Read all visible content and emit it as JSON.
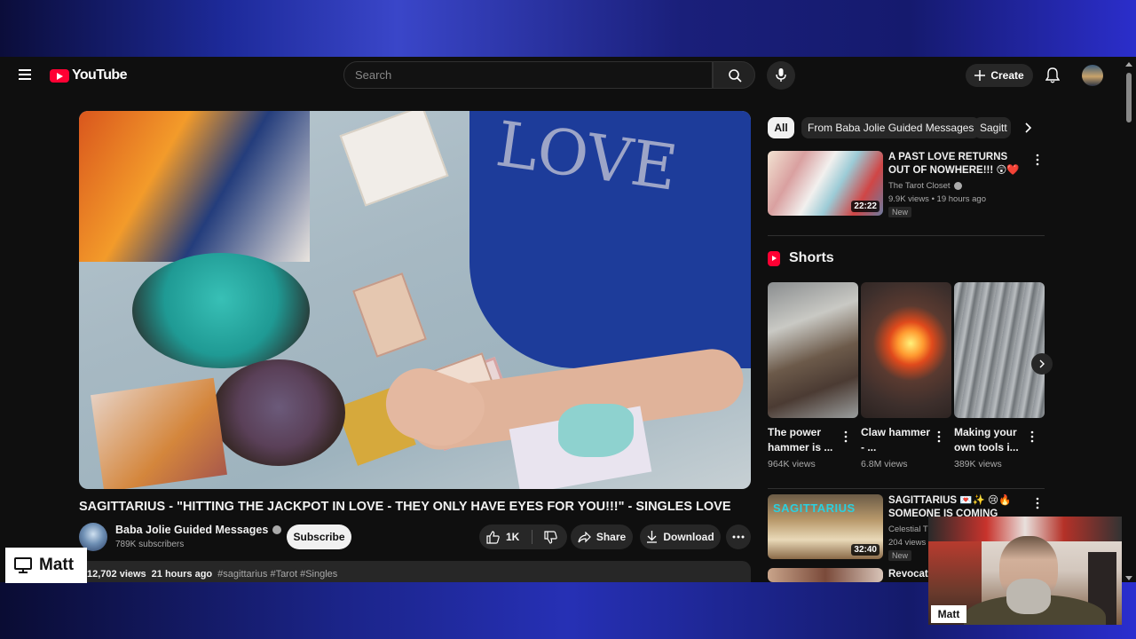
{
  "header": {
    "logo_text": "YouTube",
    "search_placeholder": "Search",
    "create_label": "Create"
  },
  "video": {
    "title": "SAGITTARIUS - \"HITTING THE JACKPOT IN LOVE - THEY ONLY HAVE EYES FOR YOU!!!\" - SINGLES LOVE",
    "shirt_text": "LOVE",
    "channel_name": "Baba Jolie Guided Messages",
    "subscribers": "789K subscribers",
    "subscribe_label": "Subscribe",
    "likes": "1K",
    "share_label": "Share",
    "download_label": "Download",
    "views": "12,702 views",
    "age": "21 hours ago",
    "tags": "#sagittarius #Tarot #Singles"
  },
  "chips": [
    "All",
    "From Baba Jolie Guided Messages",
    "Sagitt"
  ],
  "recommendations": [
    {
      "title": "A PAST LOVE RETURNS OUT OF NOWHERE!!! 😲❤️ LOVE TARO...",
      "channel": "The Tarot Closet",
      "meta": "9.9K views • 19 hours ago",
      "badge": "New",
      "duration": "22:22"
    },
    {
      "title": "SAGITTARIUS 💌✨ 😢🔥 SOMEONE IS COMING BACK T...",
      "channel": "Celestial T",
      "meta": "204 views",
      "badge": "New",
      "duration": "32:40",
      "thumb_text": "SAGITTARIUS"
    },
    {
      "title": "Revocatio",
      "channel": "",
      "meta": "",
      "badge": "",
      "duration": ""
    }
  ],
  "shorts": {
    "heading": "Shorts",
    "items": [
      {
        "title": "The power hammer is ...",
        "views": "964K views"
      },
      {
        "title": "Claw hammer - ...",
        "views": "6.8M views"
      },
      {
        "title": "Making your own tools i...",
        "views": "389K views"
      }
    ]
  },
  "overlays": {
    "screen_label": "Matt",
    "cam_label": "Matt"
  },
  "colors": {
    "background": "#0f0f0f",
    "surface": "#272727",
    "brand_red": "#ff0033",
    "text": "#f1f1f1",
    "secondary_text": "#aaaaaa"
  }
}
